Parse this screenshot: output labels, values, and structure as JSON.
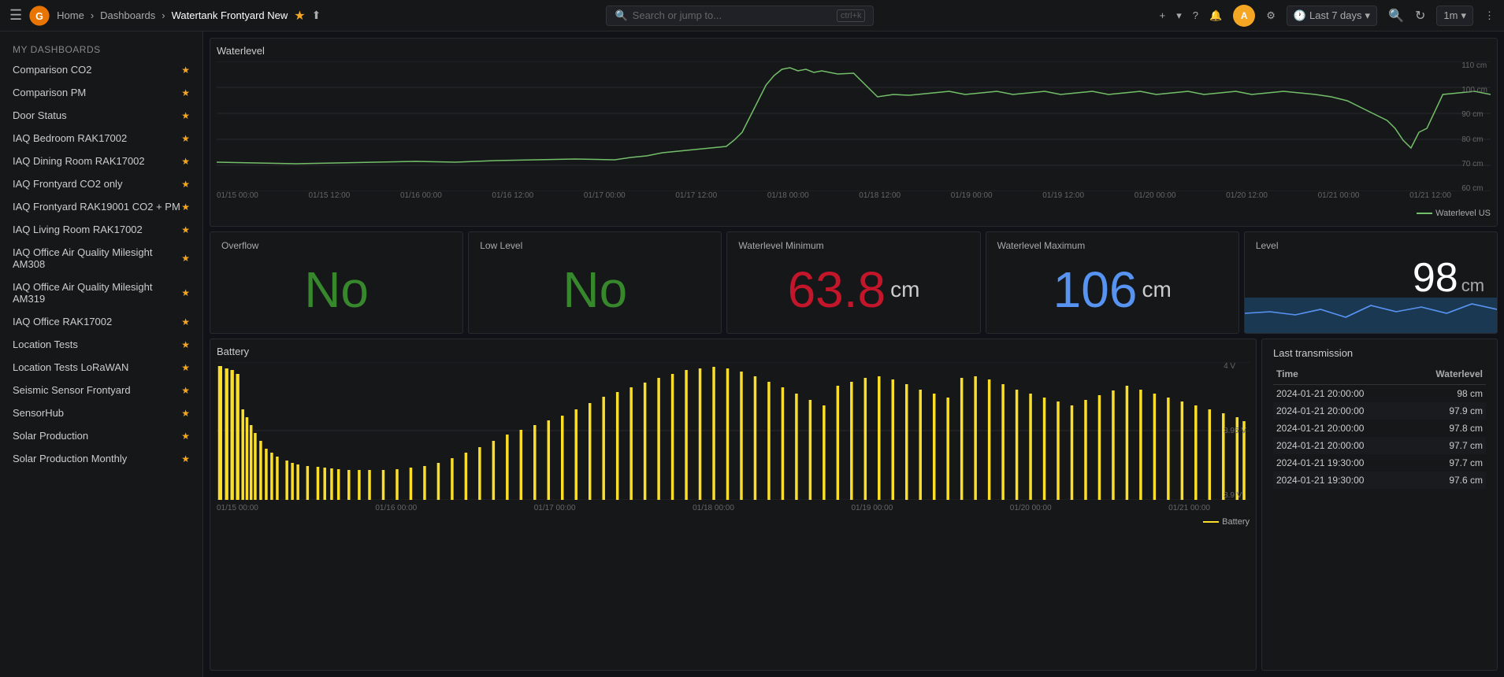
{
  "topbar": {
    "home": "Home",
    "dashboards": "Dashboards",
    "current_page": "Watertank Frontyard New",
    "search_placeholder": "Search or jump to...",
    "shortcut": "ctrl+k",
    "time_range": "Last 7 days",
    "refresh_rate": "1m"
  },
  "sidebar": {
    "title": "My Dashboards",
    "items": [
      {
        "label": "Comparison CO2"
      },
      {
        "label": "Comparison PM"
      },
      {
        "label": "Door Status"
      },
      {
        "label": "IAQ Bedroom RAK17002"
      },
      {
        "label": "IAQ Dining Room RAK17002"
      },
      {
        "label": "IAQ Frontyard CO2 only"
      },
      {
        "label": "IAQ Frontyard RAK19001 CO2 + PM"
      },
      {
        "label": "IAQ Living Room RAK17002"
      },
      {
        "label": "IAQ Office Air Quality Milesight AM308"
      },
      {
        "label": "IAQ Office Air Quality Milesight AM319"
      },
      {
        "label": "IAQ Office RAK17002"
      },
      {
        "label": "Location Tests"
      },
      {
        "label": "Location Tests LoRaWAN"
      },
      {
        "label": "Seismic Sensor Frontyard"
      },
      {
        "label": "SensorHub"
      },
      {
        "label": "Solar Production"
      },
      {
        "label": "Solar Production Monthly"
      }
    ]
  },
  "main": {
    "waterlevel_title": "Waterlevel",
    "waterlevel_legend": "Waterlevel US",
    "x_axis_labels": [
      "01/15 00:00",
      "01/15 12:00",
      "01/16 00:00",
      "01/16 12:00",
      "01/17 00:00",
      "01/17 12:00",
      "01/18 00:00",
      "01/18 12:00",
      "01/19 00:00",
      "01/19 12:00",
      "01/20 00:00",
      "01/20 12:00",
      "01/21 00:00",
      "01/21 12:00"
    ],
    "y_axis_labels": [
      "110 cm",
      "100 cm",
      "90 cm",
      "80 cm",
      "70 cm",
      "60 cm"
    ],
    "overflow_label": "Overflow",
    "overflow_value": "No",
    "lowlevel_label": "Low Level",
    "lowlevel_value": "No",
    "wl_min_label": "Waterlevel Minimum",
    "wl_min_value": "63.8",
    "wl_min_unit": "cm",
    "wl_max_label": "Waterlevel Maximum",
    "wl_max_value": "106",
    "wl_max_unit": "cm",
    "level_label": "Level",
    "level_value": "98",
    "level_unit": "cm",
    "battery_title": "Battery",
    "battery_x_labels": [
      "01/15 00:00",
      "01/16 00:00",
      "01/17 00:00",
      "01/18 00:00",
      "01/19 00:00",
      "01/20 00:00",
      "01/21 00:00"
    ],
    "battery_y_labels": [
      "4 V",
      "3.95 V",
      "3.9 V"
    ],
    "battery_legend": "Battery",
    "last_transmission_title": "Last transmission",
    "trans_col1": "Time",
    "trans_col2": "Waterlevel",
    "transmissions": [
      {
        "time": "2024-01-21 20:00:00",
        "value": "98 cm"
      },
      {
        "time": "2024-01-21 20:00:00",
        "value": "97.9 cm"
      },
      {
        "time": "2024-01-21 20:00:00",
        "value": "97.8 cm"
      },
      {
        "time": "2024-01-21 20:00:00",
        "value": "97.7 cm"
      },
      {
        "time": "2024-01-21 19:30:00",
        "value": "97.7 cm"
      },
      {
        "time": "2024-01-21 19:30:00",
        "value": "97.6 cm"
      }
    ]
  },
  "icons": {
    "menu": "☰",
    "search": "🔍",
    "star": "★",
    "share": "⬆",
    "settings": "⚙",
    "clock": "🕐",
    "zoom_out": "🔍",
    "refresh": "↻",
    "chevron_down": "▾",
    "plus": "+",
    "help": "?",
    "bell": "🔔",
    "user": "👤"
  },
  "colors": {
    "accent_green": "#37872d",
    "accent_red": "#c4162a",
    "accent_blue": "#5794f2",
    "chart_green": "#73bf69",
    "chart_yellow": "#fade2a",
    "background": "#111217",
    "panel_bg": "#161719",
    "border": "#2a2a2e"
  }
}
